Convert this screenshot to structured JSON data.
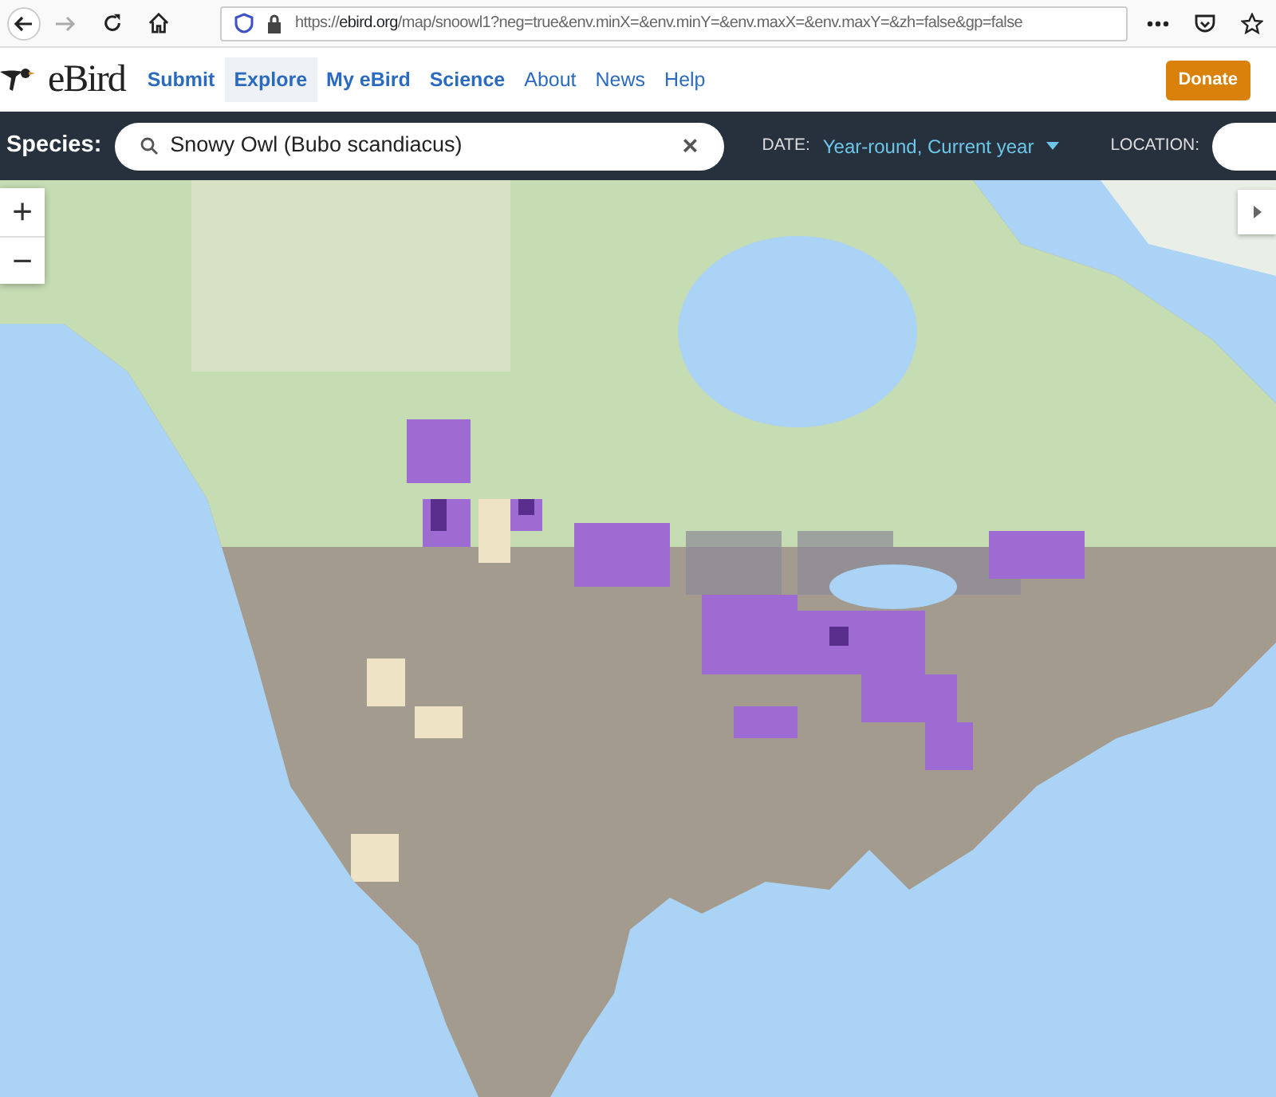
{
  "browser": {
    "url_scheme": "https://",
    "url_host": "ebird.org",
    "url_path": "/map/snoowl1?neg=true&env.minX=&env.minY=&env.maxX=&env.maxY=&zh=false&gp=false"
  },
  "site": {
    "logo": "eBird",
    "nav": [
      {
        "label": "Submit",
        "kind": "primary",
        "selected": false
      },
      {
        "label": "Explore",
        "kind": "primary",
        "selected": true
      },
      {
        "label": "My eBird",
        "kind": "primary",
        "selected": false
      },
      {
        "label": "Science",
        "kind": "primary",
        "selected": false
      },
      {
        "label": "About",
        "kind": "secondary",
        "selected": false
      },
      {
        "label": "News",
        "kind": "secondary",
        "selected": false
      },
      {
        "label": "Help",
        "kind": "secondary",
        "selected": false
      }
    ],
    "donate": "Donate"
  },
  "search_bar": {
    "label": "Species:",
    "value": "Snowy Owl (Bubo scandiacus)",
    "clear": "×",
    "date_label": "DATE:",
    "date_value": "Year-round, Current year",
    "location_label": "LOCATION:"
  },
  "map": {
    "zoom_in": "+",
    "zoom_out": "−"
  }
}
